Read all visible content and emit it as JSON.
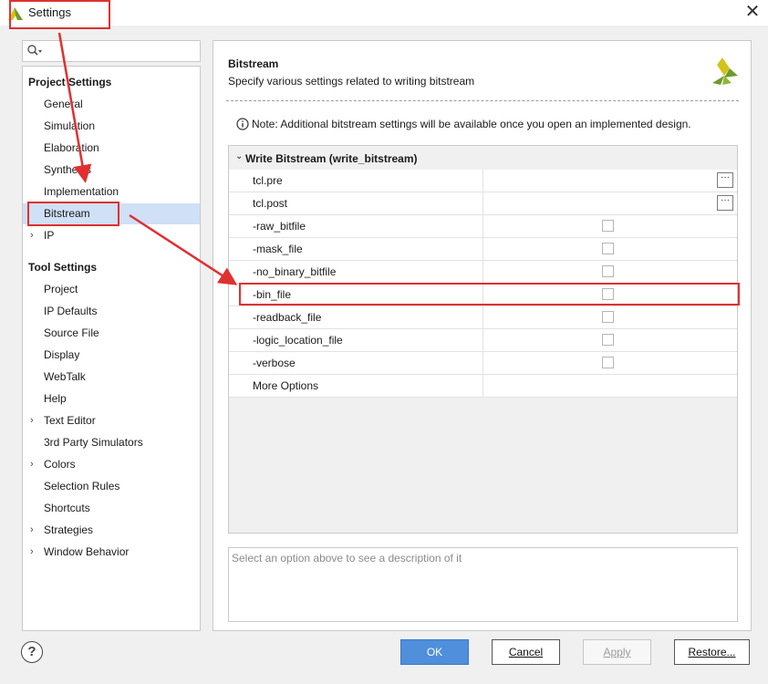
{
  "window": {
    "title": "Settings",
    "close_glyph": "✕"
  },
  "search": {
    "placeholder": "",
    "value": "",
    "icon": "search-icon"
  },
  "tree": {
    "groups": [
      {
        "label": "Project Settings",
        "items": [
          {
            "label": "General",
            "expandable": false
          },
          {
            "label": "Simulation",
            "expandable": false
          },
          {
            "label": "Elaboration",
            "expandable": false
          },
          {
            "label": "Synthesis",
            "expandable": false
          },
          {
            "label": "Implementation",
            "expandable": false
          },
          {
            "label": "Bitstream",
            "expandable": false,
            "selected": true
          },
          {
            "label": "IP",
            "expandable": true
          }
        ]
      },
      {
        "label": "Tool Settings",
        "items": [
          {
            "label": "Project",
            "expandable": false
          },
          {
            "label": "IP Defaults",
            "expandable": false
          },
          {
            "label": "Source File",
            "expandable": false
          },
          {
            "label": "Display",
            "expandable": false
          },
          {
            "label": "WebTalk",
            "expandable": false
          },
          {
            "label": "Help",
            "expandable": false
          },
          {
            "label": "Text Editor",
            "expandable": true
          },
          {
            "label": "3rd Party Simulators",
            "expandable": false
          },
          {
            "label": "Colors",
            "expandable": true
          },
          {
            "label": "Selection Rules",
            "expandable": false
          },
          {
            "label": "Shortcuts",
            "expandable": false
          },
          {
            "label": "Strategies",
            "expandable": true
          },
          {
            "label": "Window Behavior",
            "expandable": true
          }
        ]
      }
    ]
  },
  "main": {
    "title": "Bitstream",
    "subtitle": "Specify various settings related to writing bitstream",
    "note": "Note: Additional bitstream settings will be available once you open an implemented design.",
    "section": {
      "label": "Write Bitstream (write_bitstream)",
      "rows": [
        {
          "name": "tcl.pre",
          "type": "browse",
          "browse_label": "···"
        },
        {
          "name": "tcl.post",
          "type": "browse",
          "browse_label": "···"
        },
        {
          "name": "-raw_bitfile",
          "type": "checkbox",
          "checked": false
        },
        {
          "name": "-mask_file",
          "type": "checkbox",
          "checked": false
        },
        {
          "name": "-no_binary_bitfile",
          "type": "checkbox",
          "checked": false
        },
        {
          "name": "-bin_file",
          "type": "checkbox",
          "checked": false
        },
        {
          "name": "-readback_file",
          "type": "checkbox",
          "checked": false
        },
        {
          "name": "-logic_location_file",
          "type": "checkbox",
          "checked": false
        },
        {
          "name": "-verbose",
          "type": "checkbox",
          "checked": false
        },
        {
          "name": "More Options",
          "type": "text",
          "value": ""
        }
      ]
    },
    "description_placeholder": "Select an option above to see a description of it"
  },
  "footer": {
    "help_glyph": "?",
    "ok_label": "OK",
    "cancel_label": "Cancel",
    "apply_label": "Apply",
    "restore_label": "Restore..."
  },
  "colors": {
    "accent": "#4f8fdb",
    "selected_row": "#cfe0f7",
    "annotation_red": "#e03030",
    "logo_green": "#6f9a2b",
    "logo_yellow": "#d4c21a"
  }
}
